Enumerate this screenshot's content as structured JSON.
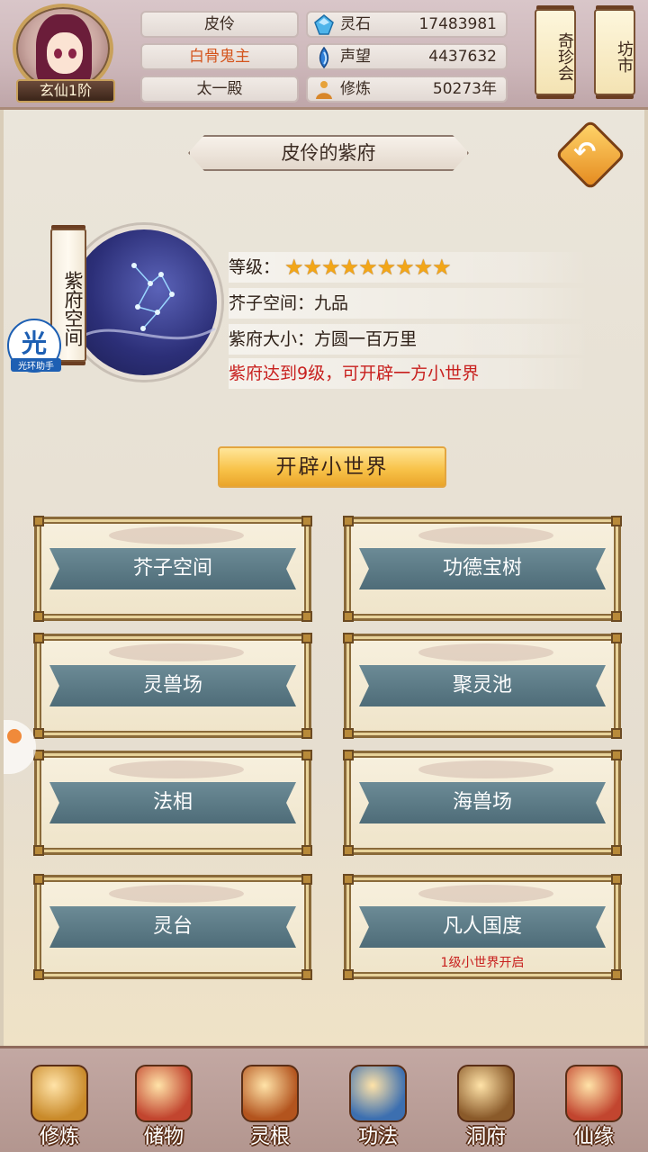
{
  "header": {
    "rank_label": "玄仙1阶",
    "name_plates": [
      "皮伶",
      "白骨鬼主",
      "太一殿"
    ],
    "stats": [
      {
        "icon": "spirit-stone-icon",
        "label": "灵石",
        "value": "17483981"
      },
      {
        "icon": "reputation-icon",
        "label": "声望",
        "value": "4437632"
      },
      {
        "icon": "cultivation-icon",
        "label": "修炼",
        "value": "50273年"
      }
    ],
    "shop_buttons": [
      "奇珍会",
      "坊市"
    ]
  },
  "panel": {
    "title": "皮伶的紫府",
    "back_icon": "back-arrow-icon",
    "scroll_label": "紫府空间",
    "helper_big": "光",
    "helper_small": "光环助手",
    "level_label": "等级：",
    "level_stars": 9,
    "space_label": "芥子空间：九品",
    "size_label": "紫府大小：方圆一百万里",
    "notice": "紫府达到9级，可开辟一方小世界",
    "open_button": "开辟小世界"
  },
  "cards": [
    {
      "label": "芥子空间",
      "note": ""
    },
    {
      "label": "功德宝树",
      "note": ""
    },
    {
      "label": "灵兽场",
      "note": ""
    },
    {
      "label": "聚灵池",
      "note": ""
    },
    {
      "label": "法相",
      "note": ""
    },
    {
      "label": "海兽场",
      "note": ""
    },
    {
      "label": "灵台",
      "note": ""
    },
    {
      "label": "凡人国度",
      "note": "1级小世界开启"
    }
  ],
  "nav": [
    {
      "label": "修炼",
      "icon": "cultivate-icon",
      "color": "#c98a2a"
    },
    {
      "label": "储物",
      "icon": "storage-bag-icon",
      "color": "#c2452f"
    },
    {
      "label": "灵根",
      "icon": "spirit-root-icon",
      "color": "#b3541e"
    },
    {
      "label": "功法",
      "icon": "technique-book-icon",
      "color": "#3c6fb0"
    },
    {
      "label": "洞府",
      "icon": "cave-house-icon",
      "color": "#8a5a2a"
    },
    {
      "label": "仙缘",
      "icon": "destiny-icon",
      "color": "#c2452f"
    }
  ]
}
